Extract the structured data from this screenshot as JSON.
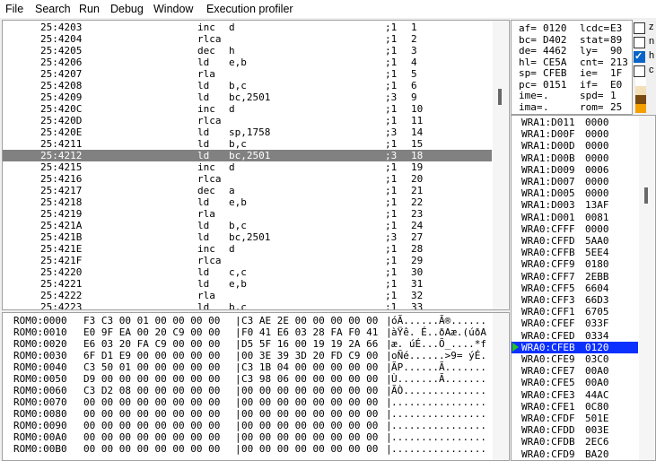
{
  "menu": [
    "File",
    "Search",
    "Run",
    "Debug",
    "Window",
    "Execution profiler"
  ],
  "disasm": [
    {
      "addr": "25:4203",
      "op": "inc",
      "args": "d",
      "cyc": ";1",
      "line": "1"
    },
    {
      "addr": "25:4204",
      "op": "rlca",
      "args": "",
      "cyc": ";1",
      "line": "2"
    },
    {
      "addr": "25:4205",
      "op": "dec",
      "args": "h",
      "cyc": ";1",
      "line": "3"
    },
    {
      "addr": "25:4206",
      "op": "ld",
      "args": "e,b",
      "cyc": ";1",
      "line": "4"
    },
    {
      "addr": "25:4207",
      "op": "rla",
      "args": "",
      "cyc": ";1",
      "line": "5"
    },
    {
      "addr": "25:4208",
      "op": "ld",
      "args": "b,c",
      "cyc": ";1",
      "line": "6"
    },
    {
      "addr": "25:4209",
      "op": "ld",
      "args": "bc,2501",
      "cyc": ";3",
      "line": "9"
    },
    {
      "addr": "25:420C",
      "op": "inc",
      "args": "d",
      "cyc": ";1",
      "line": "10"
    },
    {
      "addr": "25:420D",
      "op": "rlca",
      "args": "",
      "cyc": ";1",
      "line": "11"
    },
    {
      "addr": "25:420E",
      "op": "ld",
      "args": "sp,1758",
      "cyc": ";3",
      "line": "14"
    },
    {
      "addr": "25:4211",
      "op": "ld",
      "args": "b,c",
      "cyc": ";1",
      "line": "15"
    },
    {
      "addr": "25:4212",
      "op": "ld",
      "args": "bc,2501",
      "cyc": ";3",
      "line": "18"
    },
    {
      "addr": "25:4215",
      "op": "inc",
      "args": "d",
      "cyc": ";1",
      "line": "19"
    },
    {
      "addr": "25:4216",
      "op": "rlca",
      "args": "",
      "cyc": ";1",
      "line": "20"
    },
    {
      "addr": "25:4217",
      "op": "dec",
      "args": "a",
      "cyc": ";1",
      "line": "21"
    },
    {
      "addr": "25:4218",
      "op": "ld",
      "args": "e,b",
      "cyc": ";1",
      "line": "22"
    },
    {
      "addr": "25:4219",
      "op": "rla",
      "args": "",
      "cyc": ";1",
      "line": "23"
    },
    {
      "addr": "25:421A",
      "op": "ld",
      "args": "b,c",
      "cyc": ";1",
      "line": "24"
    },
    {
      "addr": "25:421B",
      "op": "ld",
      "args": "bc,2501",
      "cyc": ";3",
      "line": "27"
    },
    {
      "addr": "25:421E",
      "op": "inc",
      "args": "d",
      "cyc": ";1",
      "line": "28"
    },
    {
      "addr": "25:421F",
      "op": "rlca",
      "args": "",
      "cyc": ";1",
      "line": "29"
    },
    {
      "addr": "25:4220",
      "op": "ld",
      "args": "c,c",
      "cyc": ";1",
      "line": "30"
    },
    {
      "addr": "25:4221",
      "op": "ld",
      "args": "e,b",
      "cyc": ";1",
      "line": "31"
    },
    {
      "addr": "25:4222",
      "op": "rla",
      "args": "",
      "cyc": ";1",
      "line": "32"
    },
    {
      "addr": "25:4223",
      "op": "ld",
      "args": "b,c",
      "cyc": ";1",
      "line": "33"
    }
  ],
  "disasm_selected": 11,
  "hex": [
    {
      "addr": "ROM0:0000",
      "a": "F3 C3 00 01 00 00 00 00",
      "b": "C3 AE 2E 00 00 00 00 00",
      "asc": "óÃ......Ã®......"
    },
    {
      "addr": "ROM0:0010",
      "a": "E0 9F EA 00 20 C9 00 00",
      "b": "F0 41 E6 03 28 FA F0 41",
      "asc": "àŸê. É..ðAæ.(úðA"
    },
    {
      "addr": "ROM0:0020",
      "a": "E6 03 20 FA C9 00 00 00",
      "b": "D5 5F 16 00 19 19 2A 66",
      "asc": "æ. úÉ...Õ_....*f"
    },
    {
      "addr": "ROM0:0030",
      "a": "6F D1 E9 00 00 00 00 00",
      "b": "00 3E 39 3D 20 FD C9 00",
      "asc": "oÑé......>9= ýÉ."
    },
    {
      "addr": "ROM0:0040",
      "a": "C3 50 01 00 00 00 00 00",
      "b": "C3 1B 04 00 00 00 00 00",
      "asc": "ÃP......Ã......."
    },
    {
      "addr": "ROM0:0050",
      "a": "D9 00 00 00 00 00 00 00",
      "b": "C3 98 06 00 00 00 00 00",
      "asc": "Ù.......Ã......."
    },
    {
      "addr": "ROM0:0060",
      "a": "C3 D2 08 00 00 00 00 00",
      "b": "00 00 00 00 00 00 00 00",
      "asc": "ÃÒ.............."
    },
    {
      "addr": "ROM0:0070",
      "a": "00 00 00 00 00 00 00 00",
      "b": "00 00 00 00 00 00 00 00",
      "asc": "................"
    },
    {
      "addr": "ROM0:0080",
      "a": "00 00 00 00 00 00 00 00",
      "b": "00 00 00 00 00 00 00 00",
      "asc": "................"
    },
    {
      "addr": "ROM0:0090",
      "a": "00 00 00 00 00 00 00 00",
      "b": "00 00 00 00 00 00 00 00",
      "asc": "................"
    },
    {
      "addr": "ROM0:00A0",
      "a": "00 00 00 00 00 00 00 00",
      "b": "00 00 00 00 00 00 00 00",
      "asc": "................"
    },
    {
      "addr": "ROM0:00B0",
      "a": "00 00 00 00 00 00 00 00",
      "b": "00 00 00 00 00 00 00 00",
      "asc": "................"
    }
  ],
  "registers": [
    {
      "l": "af=",
      "lv": "0120",
      "r": "lcdc=",
      "rv": "E3"
    },
    {
      "l": "bc=",
      "lv": "D402",
      "r": "stat=",
      "rv": "89"
    },
    {
      "l": "de=",
      "lv": "4462",
      "r": "ly=",
      "rv": "90"
    },
    {
      "l": "hl=",
      "lv": "CE5A",
      "r": "cnt=",
      "rv": "213"
    },
    {
      "l": "sp=",
      "lv": "CFEB",
      "r": "ie=",
      "rv": "1F"
    },
    {
      "l": "pc=",
      "lv": "0151",
      "r": "if=",
      "rv": "E0"
    },
    {
      "l": "ime=",
      "lv": ".",
      "r": "spd=",
      "rv": "1"
    },
    {
      "l": "ima=",
      "lv": ".",
      "r": "rom=",
      "rv": "25"
    }
  ],
  "flags": [
    {
      "label": "z",
      "checked": false
    },
    {
      "label": "n",
      "checked": false
    },
    {
      "label": "h",
      "checked": true
    },
    {
      "label": "c",
      "checked": false
    }
  ],
  "stack": [
    {
      "addr": "WRA1:D011",
      "val": "0000"
    },
    {
      "addr": "WRA1:D00F",
      "val": "0000"
    },
    {
      "addr": "WRA1:D00D",
      "val": "0000"
    },
    {
      "addr": "WRA1:D00B",
      "val": "0000"
    },
    {
      "addr": "WRA1:D009",
      "val": "0006"
    },
    {
      "addr": "WRA1:D007",
      "val": "0000"
    },
    {
      "addr": "WRA1:D005",
      "val": "0000"
    },
    {
      "addr": "WRA1:D003",
      "val": "13AF"
    },
    {
      "addr": "WRA1:D001",
      "val": "0081"
    },
    {
      "addr": "WRA0:CFFF",
      "val": "0000"
    },
    {
      "addr": "WRA0:CFFD",
      "val": "5AA0"
    },
    {
      "addr": "WRA0:CFFB",
      "val": "5EE4"
    },
    {
      "addr": "WRA0:CFF9",
      "val": "0180"
    },
    {
      "addr": "WRA0:CFF7",
      "val": "2EBB"
    },
    {
      "addr": "WRA0:CFF5",
      "val": "6604"
    },
    {
      "addr": "WRA0:CFF3",
      "val": "66D3"
    },
    {
      "addr": "WRA0:CFF1",
      "val": "6705"
    },
    {
      "addr": "WRA0:CFEF",
      "val": "033F"
    },
    {
      "addr": "WRA0:CFED",
      "val": "0334"
    },
    {
      "addr": "WRA0:CFEB",
      "val": "0120"
    },
    {
      "addr": "WRA0:CFE9",
      "val": "03C0"
    },
    {
      "addr": "WRA0:CFE7",
      "val": "00A0"
    },
    {
      "addr": "WRA0:CFE5",
      "val": "00A0"
    },
    {
      "addr": "WRA0:CFE3",
      "val": "44AC"
    },
    {
      "addr": "WRA0:CFE1",
      "val": "0C80"
    },
    {
      "addr": "WRA0:CFDF",
      "val": "501E"
    },
    {
      "addr": "WRA0:CFDD",
      "val": "003E"
    },
    {
      "addr": "WRA0:CFDB",
      "val": "2EC6"
    },
    {
      "addr": "WRA0:CFD9",
      "val": "BA20"
    }
  ],
  "stack_selected": 19,
  "palette": [
    "#ffffff",
    "#f4e0b8",
    "#7a4a10",
    "#f3a000"
  ]
}
